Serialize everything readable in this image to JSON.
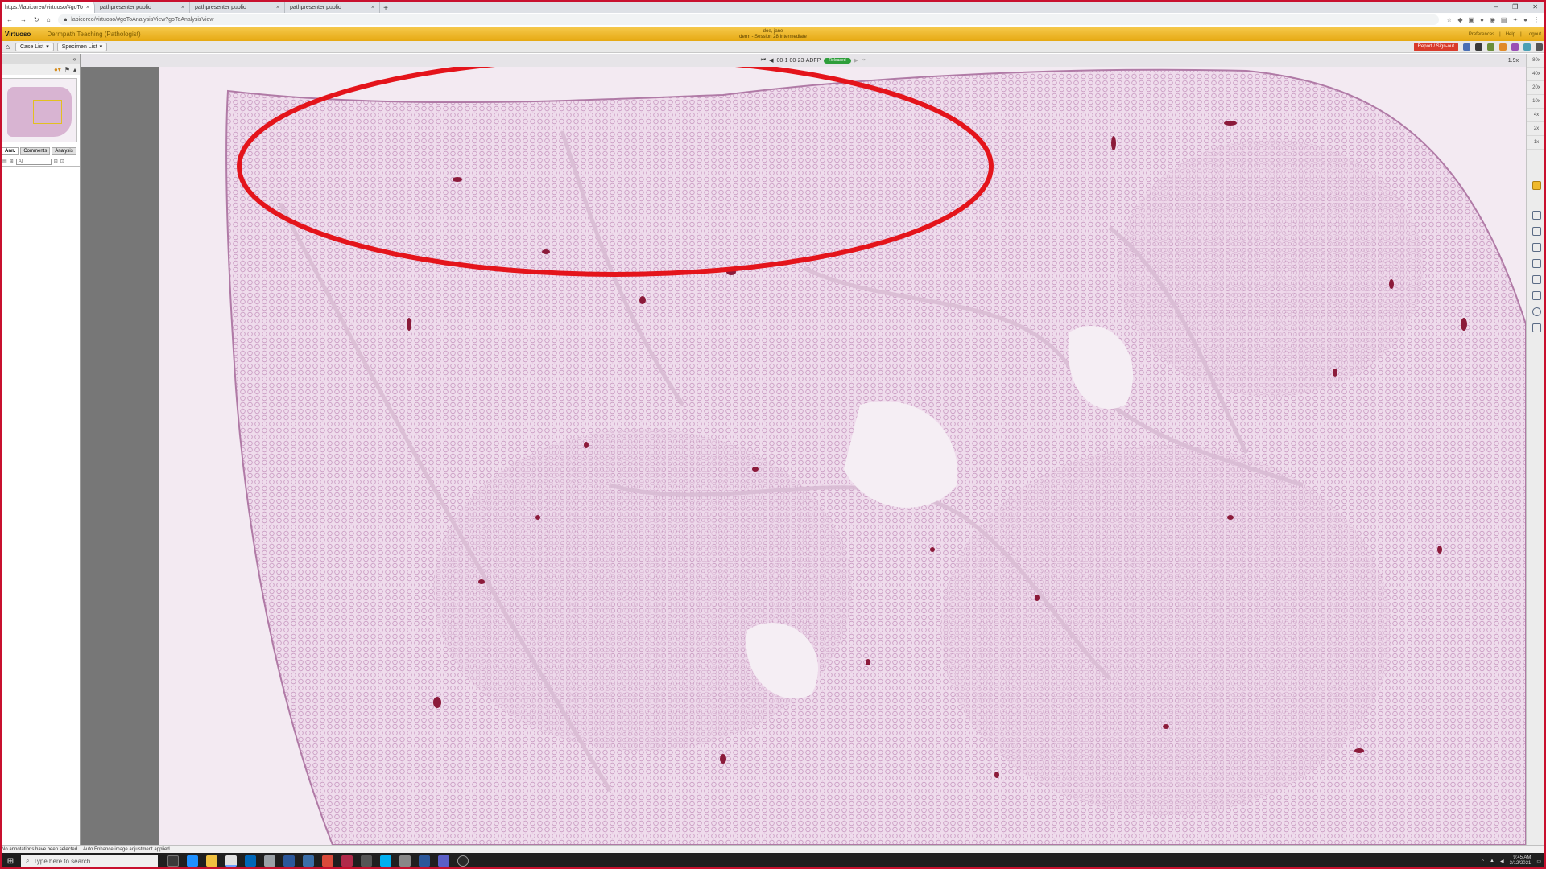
{
  "browser": {
    "tabs": [
      {
        "title": "https://labicoreo/virtuoso/#goTo",
        "active": true
      },
      {
        "title": "pathpresenter public",
        "active": false
      },
      {
        "title": "pathpresenter public",
        "active": false
      },
      {
        "title": "pathpresenter public",
        "active": false
      }
    ],
    "url": "labicoreo/virtuoso/#goToAnalysisView?goToAnalysisView",
    "new_tab_icon": "plus-icon"
  },
  "app": {
    "brand": "Virtuoso",
    "context": "Dermpath Teaching (Pathologist)",
    "user": "doe, jane",
    "session": "derm - Session 28 Intermediate",
    "links": [
      "Preferences",
      "|",
      "Help",
      "|",
      "Logout"
    ]
  },
  "toolbar": {
    "case_list": "Case List",
    "specimen_list": "Specimen List",
    "report_signout": "Report / Sign-out"
  },
  "viewer": {
    "case_id": "00-1 00-23-ADFP",
    "status": "Released",
    "zoom_display": "1.9x",
    "magnifications": [
      "80x",
      "40x",
      "20x",
      "10x",
      "4x",
      "2x",
      "1x"
    ]
  },
  "left_panel": {
    "tabs": [
      "Ann.",
      "Comments",
      "Analysis"
    ],
    "filter_value": "All"
  },
  "status": {
    "left": "No annotations have been selected",
    "main": "Auto Enhance image adjustment applied"
  },
  "taskbar": {
    "search_placeholder": "Type here to search",
    "time": "9:45 AM",
    "date": "3/12/2021"
  },
  "colors": {
    "annotation_red": "#e4141b",
    "header_gold": "#f0b92a",
    "released_green": "#2e9e3a",
    "report_red": "#d93b2b",
    "frame_red": "#c8102e"
  }
}
